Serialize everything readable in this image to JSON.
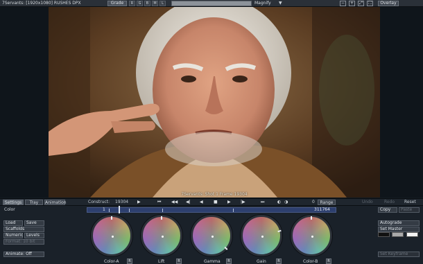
{
  "topbar": {
    "title": "7Servants: [1920x1080] RUSHES DPX",
    "grade_label": "Grade",
    "channels": [
      "R",
      "G",
      "B",
      "M",
      "L"
    ],
    "magnify_label": "Magnify",
    "overlay_label": "Overlay"
  },
  "viewer": {
    "caption": "7Servants: Shot 1 Frame 19304"
  },
  "tabs": {
    "settings": "Settings",
    "tray": "Tray",
    "animation": "Animation"
  },
  "transport": {
    "construct_label": "Construct:",
    "frame": "19304",
    "count": "0",
    "range_label": "Range",
    "undo": "Undo",
    "redo": "Redo",
    "reset": "Reset"
  },
  "color_panel": {
    "section_label": "Color",
    "timeline_start": "1",
    "timeline_end": "311764",
    "buttons": {
      "load": "Load",
      "save": "Save",
      "scaffolds": "Scaffolds",
      "numeric": "Numeric",
      "levels": "Levels",
      "format": "Format: 10 bit",
      "animate": "Animate: Off"
    },
    "wheels": [
      {
        "name": "Color-A",
        "reset": "R"
      },
      {
        "name": "Lift",
        "reset": "R"
      },
      {
        "name": "Gamma",
        "reset": "R"
      },
      {
        "name": "Gain",
        "reset": "R"
      },
      {
        "name": "Color-B",
        "reset": "R"
      }
    ],
    "right_buttons": {
      "copy": "Copy",
      "paste": "Paste",
      "autograde": "Autograde",
      "set_master": "Set Master",
      "set_keyframe": "Set Keyframe"
    }
  },
  "colors": {
    "timeline": "#2d3f6e",
    "panel": "#1a2129",
    "accent": "#5a626c"
  }
}
